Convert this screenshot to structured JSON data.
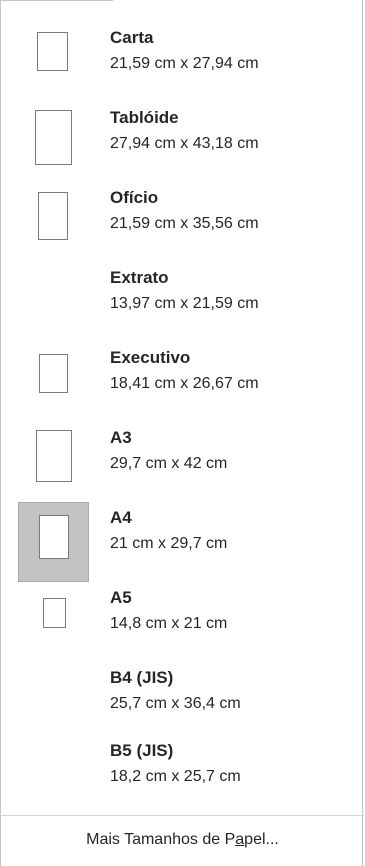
{
  "menu": {
    "items": [
      {
        "name": "Carta",
        "dims": "21,59 cm x 27,94 cm",
        "selected": false
      },
      {
        "name": "Tablóide",
        "dims": "27,94 cm x 43,18 cm",
        "selected": false
      },
      {
        "name": "Ofício",
        "dims": "21,59 cm x 35,56 cm",
        "selected": false
      },
      {
        "name": "Extrato",
        "dims": "13,97 cm x 21,59 cm",
        "selected": false
      },
      {
        "name": "Executivo",
        "dims": "18,41 cm x 26,67 cm",
        "selected": false
      },
      {
        "name": "A3",
        "dims": "29,7 cm x 42 cm",
        "selected": false
      },
      {
        "name": "A4",
        "dims": "21 cm x 29,7 cm",
        "selected": true
      },
      {
        "name": "A5",
        "dims": "14,8 cm x 21 cm",
        "selected": false
      },
      {
        "name": "B4 (JIS)",
        "dims": "25,7 cm x 36,4 cm",
        "selected": false
      },
      {
        "name": "B5 (JIS)",
        "dims": "18,2 cm x 25,7 cm",
        "selected": false
      }
    ],
    "more_label_pre": "Mais Tamanhos de P",
    "more_label_underlined": "a",
    "more_label_post": "pel...",
    "icons": {
      "paper_thumbnail": "page-outline-icon"
    },
    "colors": {
      "selected_bg": "#c3c3c3",
      "text": "#262626",
      "border": "#c6c6c6"
    }
  }
}
